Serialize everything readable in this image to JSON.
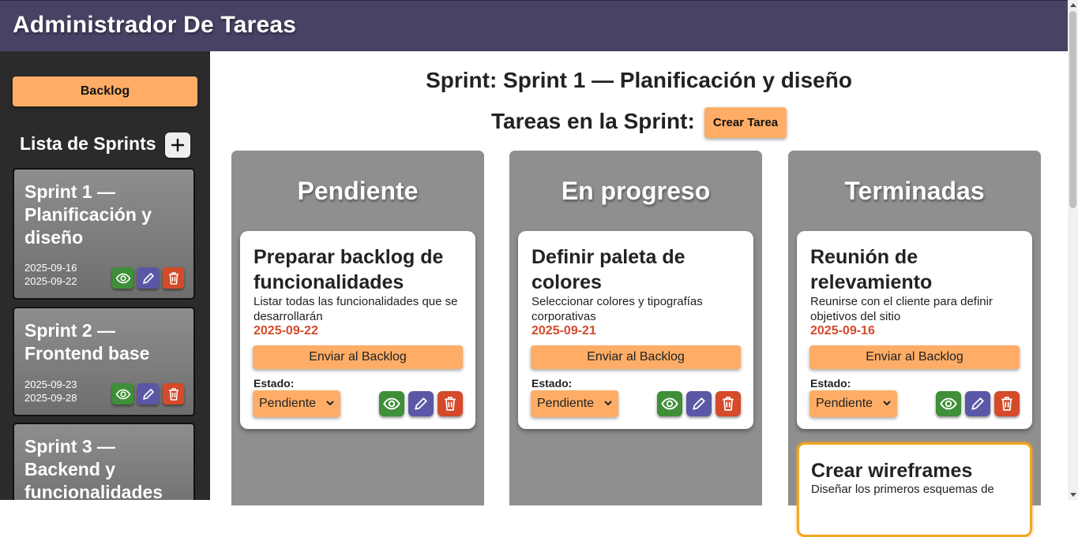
{
  "header": {
    "title": "Administrador De Tareas"
  },
  "sidebar": {
    "backlog_label": "Backlog",
    "sprints_heading": "Lista de Sprints",
    "sprints": [
      {
        "name": "Sprint 1 — Planificación y diseño",
        "start": "2025-09-16",
        "end": "2025-09-22"
      },
      {
        "name": "Sprint 2 — Frontend base",
        "start": "2025-09-23",
        "end": "2025-09-28"
      },
      {
        "name": "Sprint 3 — Backend y funcionalidades"
      }
    ]
  },
  "main": {
    "title": "Sprint: Sprint 1 — Planificación y diseño",
    "tasks_label": "Tareas en la Sprint:",
    "create_label": "Crear Tarea",
    "columns": [
      {
        "title": "Pendiente",
        "tasks": [
          {
            "title": "Preparar backlog de funcionalidades",
            "description": "Listar todas las funcionalidades que se desarrollarán",
            "date": "2025-09-22",
            "send_label": "Enviar al Backlog",
            "estado_label": "Estado:",
            "estado_value": "Pendiente"
          }
        ]
      },
      {
        "title": "En progreso",
        "tasks": [
          {
            "title": "Definir paleta de colores",
            "description": "Seleccionar colores y tipografías corporativas",
            "date": "2025-09-21",
            "send_label": "Enviar al Backlog",
            "estado_label": "Estado:",
            "estado_value": "Pendiente"
          }
        ]
      },
      {
        "title": "Terminadas",
        "tasks": [
          {
            "title": "Reunión de relevamiento",
            "description": "Reunirse con el cliente para definir objetivos del sitio",
            "date": "2025-09-16",
            "send_label": "Enviar al Backlog",
            "estado_label": "Estado:",
            "estado_value": "Pendiente"
          },
          {
            "title": "Crear wireframes",
            "description": "Diseñar los primeros esquemas de"
          }
        ]
      }
    ]
  },
  "colors": {
    "header": "#4a4265",
    "sidebar": "#2b2b2b",
    "accent": "#ffad66",
    "view": "#3e8f37",
    "edit": "#5a58a6",
    "delete": "#d44a2a",
    "date": "#d44a2a",
    "column": "#8f8f8f"
  },
  "icons": {
    "view": "eye-icon",
    "edit": "pencil-icon",
    "delete": "trash-icon",
    "add": "plus-icon"
  }
}
